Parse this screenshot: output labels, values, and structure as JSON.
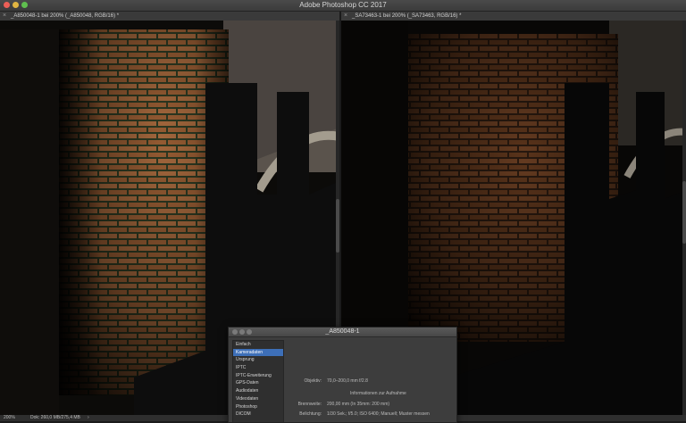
{
  "app": {
    "title": "Adobe Photoshop CC 2017"
  },
  "documents": [
    {
      "tab_label": "_A850048-1 bei 200% (_A850048, RGB/16) *"
    },
    {
      "tab_label": "_SA73463-1 bei 200% (_SA73463, RGB/16) *"
    }
  ],
  "status_bar": {
    "zoom": "200%",
    "doc_info": "Dok: 260,0 MB/275,4 MB"
  },
  "file_info_dialog": {
    "title": "_A850048-1",
    "categories": [
      "Einfach",
      "Kameradaten",
      "Ursprung",
      "IPTC",
      "IPTC-Erweiterung",
      "GPS-Daten",
      "Audiodaten",
      "Videodaten",
      "Photoshop",
      "DICOM"
    ],
    "selected_category": "Kameradaten",
    "objective_label": "Objektiv:",
    "objective_value": "70,0–200,0 mm f/2.8",
    "section_title": "Informationen zur Aufnahme",
    "focal_label": "Brennweite:",
    "focal_value": "200,00 mm   (In 35mm: 200 mm)",
    "exposure_label": "Belichtung:",
    "exposure_value": "1/30 Sek.;   f/5.0;   ISO 6400;   Manuell;   Muster messen"
  },
  "colors": {
    "brick_warm": "#a86a3e",
    "brick_warm_dark": "#6e4224",
    "mortar_green": "#2e3a22",
    "brick_dim": "#6a3e22",
    "selection_blue": "#3d6fb8"
  },
  "icons": {
    "tab_close": "×"
  }
}
